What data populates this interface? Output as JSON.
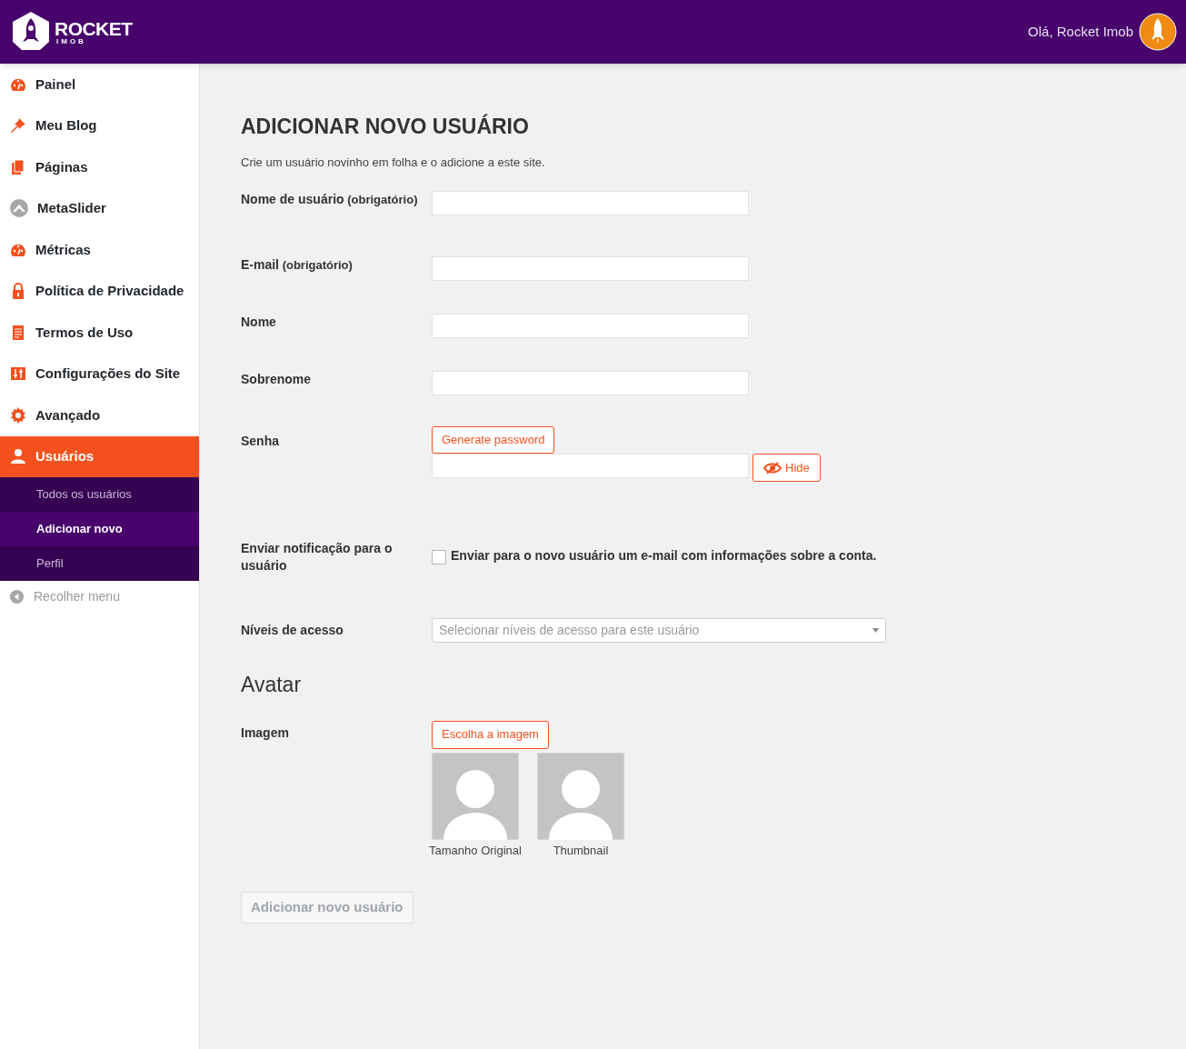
{
  "header": {
    "logo_text": "ROCKET",
    "logo_subtext": "IMOB",
    "greeting": "Olá, Rocket Imob"
  },
  "sidebar": {
    "items": [
      {
        "label": "Painel",
        "selected": false
      },
      {
        "label": "Meu Blog",
        "selected": false
      },
      {
        "label": "Páginas",
        "selected": false
      },
      {
        "label": "MetaSlider",
        "selected": false
      },
      {
        "label": "Métricas",
        "selected": false
      },
      {
        "label": "Política de Privacidade",
        "selected": false
      },
      {
        "label": "Termos de Uso",
        "selected": false
      },
      {
        "label": "Configurações do Site",
        "selected": false
      },
      {
        "label": "Avançado",
        "selected": false
      },
      {
        "label": "Usuários",
        "selected": true,
        "children": [
          {
            "label": "Todos os usuários",
            "selected": false
          },
          {
            "label": "Adicionar novo",
            "selected": true
          },
          {
            "label": "Perfil",
            "selected": false
          }
        ]
      }
    ],
    "collapse": "Recolher menu"
  },
  "page": {
    "title": "ADICIONAR NOVO USUÁRIO",
    "description": "Crie um usuário novinho em folha e o adicione a este site.",
    "fields": [
      {
        "kind": "text",
        "label": "Nome de usuário",
        "note": "(obrigatório)"
      },
      {
        "kind": "text",
        "label": "E-mail",
        "note": "(obrigatório)"
      },
      {
        "kind": "text",
        "label": "Nome"
      },
      {
        "kind": "text",
        "label": "Sobrenome"
      },
      {
        "kind": "password",
        "label": "Senha",
        "generate_button": "Generate password",
        "toggle_button": "Hide"
      },
      {
        "kind": "checkbox",
        "label": "Enviar notificação para o usuário",
        "checkbox_label": "Enviar para o novo usuário um e-mail com informações sobre a conta.",
        "checked": false
      },
      {
        "kind": "select",
        "label": "Níveis de acesso",
        "placeholder": "Selecionar níveis de acesso para este usuário"
      }
    ],
    "avatar": {
      "heading": "Avatar",
      "label": "Imagem",
      "button": "Escolha a imagem",
      "previews": [
        "Tamanho Original",
        "Thumbnail"
      ]
    },
    "submit": {
      "label": "Adicionar novo usuário",
      "disabled": true
    }
  }
}
